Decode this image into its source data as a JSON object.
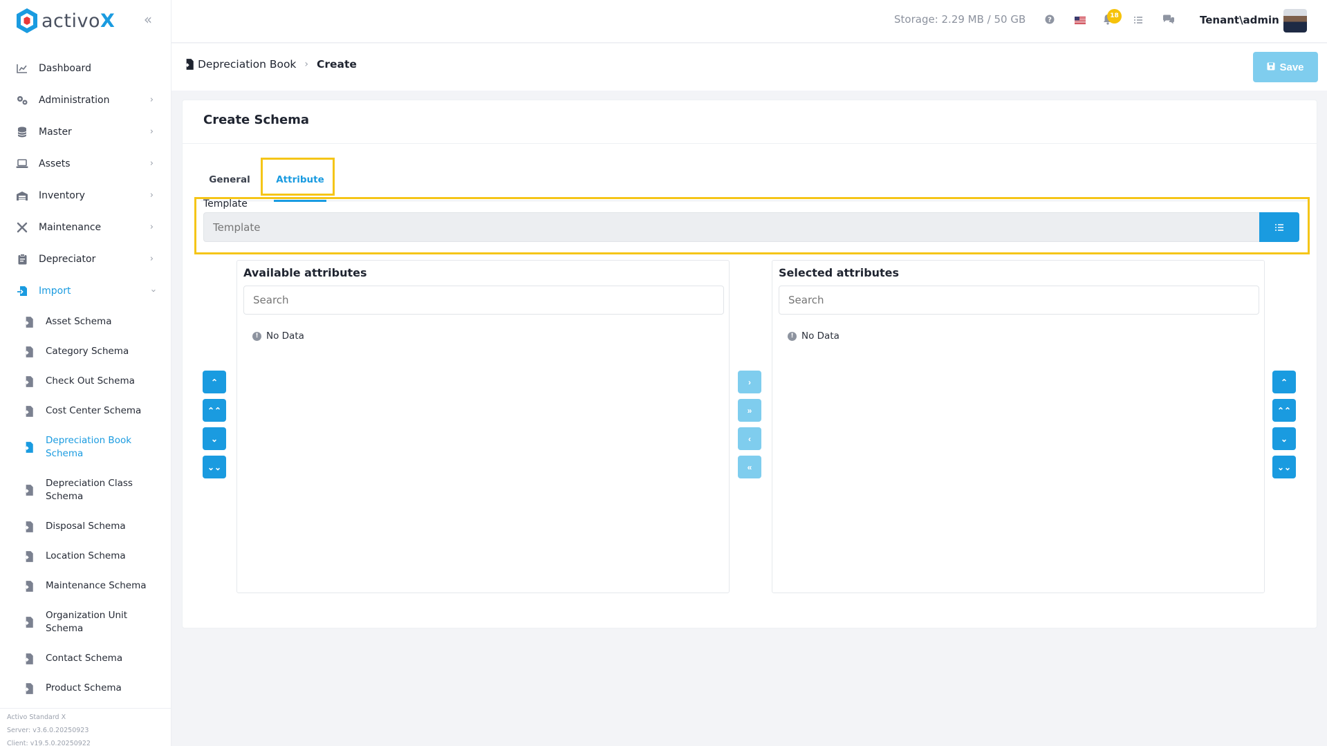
{
  "brand": {
    "name_prefix": "activo",
    "name_suffix": "X"
  },
  "sidebar": {
    "items": [
      {
        "label": "Dashboard",
        "icon": "chart-icon"
      },
      {
        "label": "Administration",
        "icon": "gears-icon"
      },
      {
        "label": "Master",
        "icon": "database-icon"
      },
      {
        "label": "Assets",
        "icon": "laptop-icon"
      },
      {
        "label": "Inventory",
        "icon": "warehouse-icon"
      },
      {
        "label": "Maintenance",
        "icon": "tools-icon"
      },
      {
        "label": "Depreciator",
        "icon": "clipboard-icon"
      },
      {
        "label": "Import",
        "icon": "import-icon"
      }
    ],
    "sub_items": [
      {
        "label": "Asset Schema"
      },
      {
        "label": "Category Schema"
      },
      {
        "label": "Check Out Schema"
      },
      {
        "label": "Cost Center Schema"
      },
      {
        "label": "Depreciation Book Schema"
      },
      {
        "label": "Depreciation Class Schema"
      },
      {
        "label": "Disposal Schema"
      },
      {
        "label": "Location Schema"
      },
      {
        "label": "Maintenance Schema"
      },
      {
        "label": "Organization Unit Schema"
      },
      {
        "label": "Contact Schema"
      },
      {
        "label": "Product Schema"
      }
    ],
    "footer": {
      "edition": "Activo Standard X",
      "server": "Server: v3.6.0.20250923",
      "client": "Client: v19.5.0.20250922"
    }
  },
  "header": {
    "storage": "Storage: 2.29 MB / 50 GB",
    "notification_count": "18",
    "user": "Tenant\\admin"
  },
  "breadcrumb": {
    "parent": "Depreciation Book",
    "current": "Create"
  },
  "toolbar": {
    "save_label": "Save"
  },
  "card": {
    "title": "Create Schema",
    "tabs": [
      {
        "label": "General"
      },
      {
        "label": "Attribute"
      }
    ],
    "template": {
      "label": "Template",
      "placeholder": "Template"
    },
    "available": {
      "title": "Available attributes",
      "search_placeholder": "Search",
      "empty": "No Data"
    },
    "selected": {
      "title": "Selected attributes",
      "search_placeholder": "Search",
      "empty": "No Data"
    }
  },
  "colors": {
    "accent": "#1a9be0",
    "highlight": "#f5c518",
    "accent_light": "#7fcdee"
  }
}
